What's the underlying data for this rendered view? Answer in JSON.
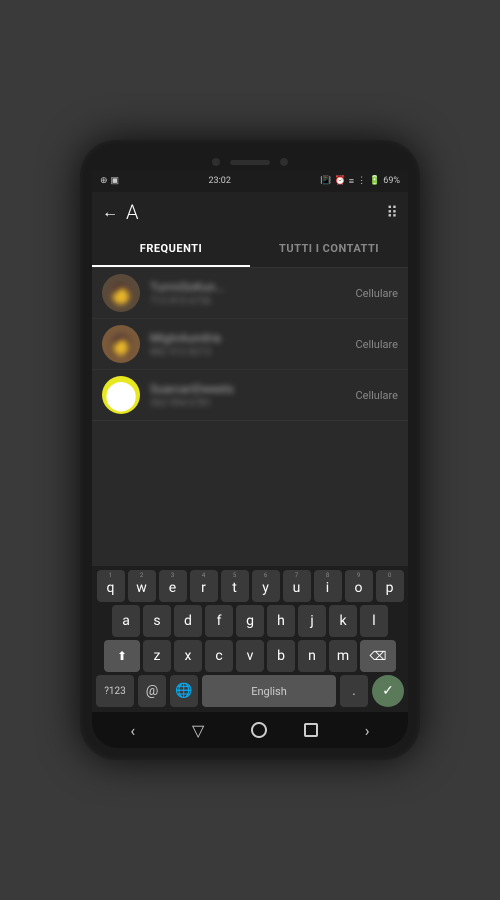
{
  "statusBar": {
    "time": "23:02",
    "battery": "69%",
    "leftIcons": [
      "⊕",
      "▣"
    ]
  },
  "header": {
    "backLabel": "←",
    "letter": "A",
    "gridLabel": "⠿"
  },
  "tabs": [
    {
      "id": "frequenti",
      "label": "FREQUENTI",
      "active": true
    },
    {
      "id": "tutti",
      "label": "TUTTI I CONTATTI",
      "active": false
    }
  ],
  "contacts": [
    {
      "id": 1,
      "name": "TurmiSoKun...",
      "number": "712 815 6736",
      "type": "Cellulare",
      "avatarEmoji": "👤",
      "avatarColor": "#5a4a3a"
    },
    {
      "id": 2,
      "name": "MiginAundria",
      "number": "882 512 8213",
      "type": "Cellulare",
      "avatarEmoji": "👤",
      "avatarColor": "#7a5a3a"
    },
    {
      "id": 3,
      "name": "SuarcariDweets",
      "number": "362 994 6781",
      "type": "Cellulare",
      "avatarEmoji": "⬤",
      "avatarColor": "#e8e820"
    }
  ],
  "keyboard": {
    "row1": [
      {
        "key": "q",
        "num": "1"
      },
      {
        "key": "w",
        "num": "2"
      },
      {
        "key": "e",
        "num": "3"
      },
      {
        "key": "r",
        "num": "4"
      },
      {
        "key": "t",
        "num": "5"
      },
      {
        "key": "y",
        "num": "6"
      },
      {
        "key": "u",
        "num": "7"
      },
      {
        "key": "i",
        "num": "8"
      },
      {
        "key": "o",
        "num": "9"
      },
      {
        "key": "p",
        "num": "0"
      }
    ],
    "row2": [
      {
        "key": "a"
      },
      {
        "key": "s"
      },
      {
        "key": "d"
      },
      {
        "key": "f"
      },
      {
        "key": "g"
      },
      {
        "key": "h"
      },
      {
        "key": "j"
      },
      {
        "key": "k"
      },
      {
        "key": "l"
      }
    ],
    "row3": [
      {
        "key": "z"
      },
      {
        "key": "x"
      },
      {
        "key": "c"
      },
      {
        "key": "v"
      },
      {
        "key": "b"
      },
      {
        "key": "n"
      },
      {
        "key": "m"
      }
    ],
    "specialRow": {
      "sym": "?123",
      "at": "@",
      "globe": "🌐",
      "space": "English",
      "period": ".",
      "enter": "✓"
    }
  },
  "navBar": {
    "back": "‹",
    "nav": "▽",
    "forward": "›"
  }
}
